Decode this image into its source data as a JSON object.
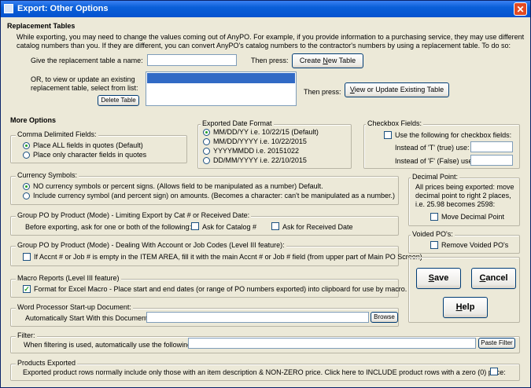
{
  "window": {
    "title": "Export: Other Options",
    "close_glyph": "✕"
  },
  "replacement": {
    "header": "Replacement Tables",
    "desc1": "While exporting, you may need to change the values coming out of AnyPO.  For example, if you provide information to a purchasing service, they may use different",
    "desc2": "catalog numbers than you.  If they are different, you can convert AnyPO's catalog numbers to the contractor's numbers by using a replacement table.  To do so:",
    "name_label": "Give the replacement table a name:",
    "name_value": "",
    "then_press": "Then press:",
    "create_pre": "Create ",
    "create_u": "N",
    "create_post": "ew Table",
    "or_line1": "OR, to view or update an existing",
    "or_line2": "replacement table, select from list:",
    "delete_label": "Delete Table",
    "then_press2": "Then press:",
    "view_pre": "",
    "view_u": "V",
    "view_post": "iew or Update Existing Table"
  },
  "more_options": {
    "header": "More Options"
  },
  "comma": {
    "title": "Comma Delimited Fields:",
    "opt1": "Place ALL fields in quotes (Default)",
    "opt2": "Place only character fields in quotes"
  },
  "date": {
    "title": "Exported Date Format",
    "opt1": "MM/DD/YY   i.e. 10/22/15 (Default)",
    "opt2": "MM/DD/YYYY  i.e. 10/22/2015",
    "opt3": "YYYYMMDD i.e. 20151022",
    "opt4": "DD/MM/YYYY i.e. 22/10/2015"
  },
  "checkbox_fields": {
    "title": "Checkbox Fields:",
    "use_label": "Use the following for checkbox fields:",
    "true_label": "Instead of 'T' (true) use:",
    "false_label": "Instead of 'F' (False) use:",
    "true_value": "",
    "false_value": ""
  },
  "currency": {
    "title": "Currency Symbols:",
    "opt1": "NO currency symbols or percent signs.  (Allows field to be manipulated as a number)  Default.",
    "opt2": "Include currency symbol (and percent sign) on amounts. (Becomes a character: can't be manipulated as a number.)"
  },
  "decimal": {
    "title": "Decimal Point:",
    "line1": "All prices being exported: move",
    "line2": "decimal point to right 2 places,",
    "line3": "i.e. 25.98 becomes 2598:",
    "chk_label": "Move Decimal Point"
  },
  "group_cat": {
    "title": "Group PO by Product (Mode) - Limiting Export by Cat # or Received Date:",
    "line": "Before exporting, ask for one or both of the following:",
    "chk1": "Ask for Catalog #",
    "chk2": "Ask for Received Date"
  },
  "voided": {
    "title": "Voided PO's:",
    "chk_label": "Remove Voided PO's"
  },
  "group_acct": {
    "title": "Group PO by Product (Mode) - Dealing With Account or Job Codes (Level III feature):",
    "chk_label": "If Accnt # or Job # is empty in the ITEM AREA, fill it with the main Accnt # or Job # field (from upper part of Main PO Screen)"
  },
  "macro": {
    "title": "Macro Reports (Level III feature)",
    "chk_label": "Format for Excel Macro - Place start and end dates (or range of PO numbers exported) into clipboard for use by macro.",
    "checked": true
  },
  "wp": {
    "title": "Word Processor Start-up Document:",
    "label": "Automatically Start With this Document:",
    "value": "",
    "browse": "Browse"
  },
  "filter": {
    "title": "Filter:",
    "label": "When filtering is used, automatically use the following",
    "value": "",
    "paste": "Paste Filter"
  },
  "products": {
    "title": "Products Exported",
    "line": "Exported product rows normally include only those with an item description & NON-ZERO price.  Click here to INCLUDE product rows with a zero (0) price:"
  },
  "actions": {
    "save_u": "S",
    "save_post": "ave",
    "cancel_u": "C",
    "cancel_post": "ancel",
    "help_u": "H",
    "help_post": "elp"
  },
  "check_glyph": "✓"
}
